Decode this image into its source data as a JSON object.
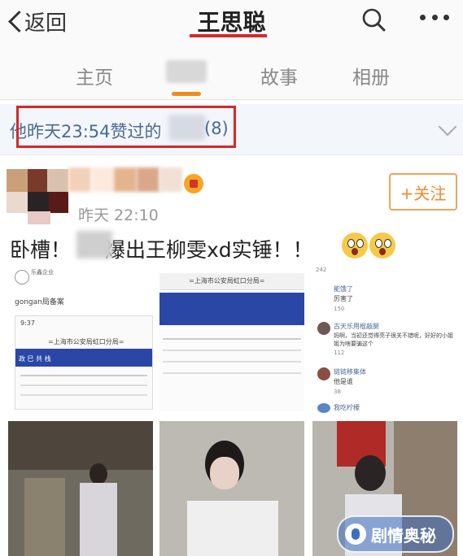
{
  "header": {
    "back_label": "返回",
    "title": "王思聪"
  },
  "tabs": [
    {
      "label": "主页"
    },
    {
      "label": "故事"
    },
    {
      "label": "相册"
    }
  ],
  "colors": {
    "accent": "#d8272c",
    "tab_indicator": "#f08c1c",
    "link": "#4a6a96",
    "follow": "#f08a2c"
  },
  "like_bar": {
    "prefix": "他昨天23:54赞过的",
    "count": "(8)"
  },
  "post": {
    "time": "昨天 22:10",
    "follow_label": "+关注",
    "text_before": "卧槽！",
    "text_after": "爆出王柳雯xd实锤！！",
    "images": {
      "doc1": {
        "heading": "gongan局备案",
        "account": "乐鑫企业",
        "clock": "9:37",
        "site_title": "=上海市公安局虹口分局=",
        "banner": "政 巳 共 栈"
      },
      "doc2": {
        "site_title": "=上海市公安局虹口分局="
      },
      "comments": [
        {
          "likes": "242"
        },
        {
          "name": "能饿了",
          "text": "厉害了",
          "likes": "150"
        },
        {
          "name": "古天乐用棍敲腿",
          "text": "妈啊，当初还觉得亮子很关不错呢，好好的小姐姐为啥要骗这个",
          "likes": "112"
        },
        {
          "name": "链链移集体",
          "text": "他是谁",
          "likes": "38"
        },
        {
          "name": "我吃柠檬"
        }
      ]
    }
  },
  "watermark": {
    "text": "剧情奥秘"
  }
}
